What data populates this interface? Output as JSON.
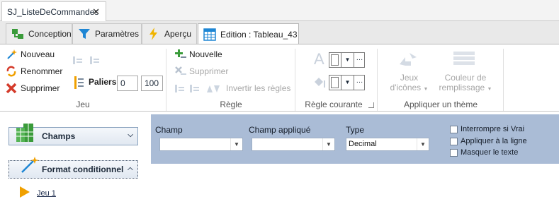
{
  "document_tab": {
    "title": "SJ_ListeDeCommandes",
    "close_glyph": "✕"
  },
  "ribbon_tabs": [
    {
      "label": "Conception",
      "icon": "conception-icon"
    },
    {
      "label": "Paramètres",
      "icon": "filter-icon"
    },
    {
      "label": "Aperçu",
      "icon": "lightning-icon"
    },
    {
      "label": "Edition : Tableau_43",
      "icon": "table-icon"
    }
  ],
  "ribbon": {
    "jeu": {
      "label": "Jeu",
      "nouveau": "Nouveau",
      "renommer": "Renommer",
      "supprimer": "Supprimer",
      "paliers_label": "Paliers",
      "paliers_min": "0",
      "paliers_max": "100"
    },
    "regle": {
      "label": "Règle",
      "nouvelle": "Nouvelle",
      "supprimer": "Supprimer",
      "inverser": "Invertir les règles"
    },
    "regle_courante": {
      "label": "Règle courante",
      "font_glyph": "A"
    },
    "theme": {
      "label": "Appliquer un thème",
      "jeux_line1": "Jeux",
      "jeux_line2": "d'icônes",
      "couleur_line1": "Couleur de",
      "couleur_line2": "remplissage"
    }
  },
  "left_panel": {
    "champs": "Champs",
    "format_conditionnel": "Format conditionnel",
    "jeu_link": "Jeu 1"
  },
  "form": {
    "champ_label": "Champ",
    "champ_value": "",
    "champ_applique_label": "Champ appliqué",
    "champ_applique_value": "",
    "type_label": "Type",
    "type_value": "Decimal",
    "checkboxes": [
      {
        "label": "Interrompre si Vrai",
        "checked": false
      },
      {
        "label": "Appliquer à la ligne",
        "checked": false
      },
      {
        "label": "Masquer le texte",
        "checked": false
      }
    ]
  },
  "colors": {
    "form_bg": "#aabcd6",
    "accent_blue": "#1e86d4",
    "green": "#3a9b3a",
    "red": "#d43a2a",
    "orange": "#f0a000"
  }
}
